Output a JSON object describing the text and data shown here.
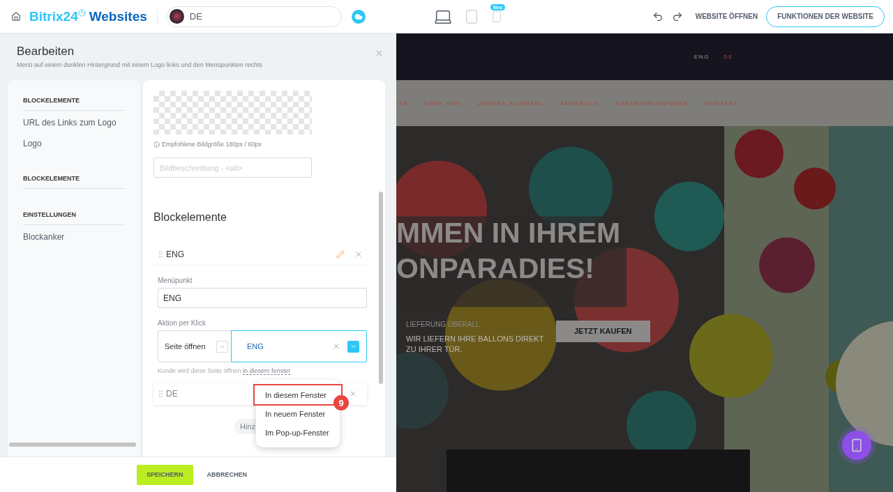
{
  "header": {
    "logo": {
      "brand": "Bitrix24",
      "product": "Websites"
    },
    "site_selector": {
      "value": "DE"
    },
    "devices": [
      {
        "kind": "laptop",
        "selected": true
      },
      {
        "kind": "tablet",
        "selected": false
      },
      {
        "kind": "phone",
        "selected": false,
        "badge": "Neu"
      }
    ],
    "open_link": "WEBSITE ÖFFNEN",
    "primary_button": "FUNKTIONEN DER WEBSITE"
  },
  "editor": {
    "title": "Bearbeiten",
    "subtitle": "Menü auf einem dunklen Hintergrund mit einem Logo links und den Menüpunkten rechts",
    "sidebar": [
      {
        "heading": "BLOCKELEMENTE",
        "items": [
          "URL des Links zum Logo",
          "Logo"
        ]
      },
      {
        "heading": "BLOCKELEMENTE"
      },
      {
        "heading": "EINSTELLUNGEN",
        "items": [
          "Blockanker"
        ]
      }
    ],
    "content": {
      "image_hint": "Empfohlene Bildgröße 180px / 60px",
      "alt_field": {
        "placeholder": "Bildbeschreibung - <alt>"
      },
      "section_title": "Blockelemente",
      "items": [
        {
          "title": "ENG",
          "expanded": true
        },
        {
          "title": "DE",
          "expanded": false
        }
      ],
      "menu_item": {
        "label": "Menüpunkt",
        "value": "ENG"
      },
      "action": {
        "label": "Aktion per Klick",
        "type": "Seite öffnen",
        "target": "ENG",
        "hint": "Kunde wird diese Seite öffnen",
        "hint_link": "in diesem fenster"
      },
      "add_button": "Hinz",
      "dropdown": [
        {
          "label": "In diesem Fenster",
          "selected": true
        },
        {
          "label": "In neuem Fenster",
          "selected": false
        },
        {
          "label": "Im Pop-up-Fenster",
          "selected": false
        }
      ],
      "annotation": "9"
    },
    "footer": {
      "save": "SPEICHERN",
      "cancel": "ABBRECHEN"
    }
  },
  "preview": {
    "languages": [
      {
        "label": "ENG",
        "selected": false
      },
      {
        "label": "DE",
        "selected": true
      }
    ],
    "nav": [
      "ITE",
      "ÜBER UNS",
      "UNSERE AUSWAHL",
      "ANGEBOTE",
      "KUNDENMEINUNGEN",
      "KONTAKT"
    ],
    "headline": [
      "MMEN IN IHREM",
      "ONPARADIES!"
    ],
    "tagline": "LIEFERUNG ÜBERALL",
    "text": "WIR LIEFERN IHRE BALLONS DIREKT ZU IHRER TÜR.",
    "cta": "JETZT KAUFEN"
  }
}
